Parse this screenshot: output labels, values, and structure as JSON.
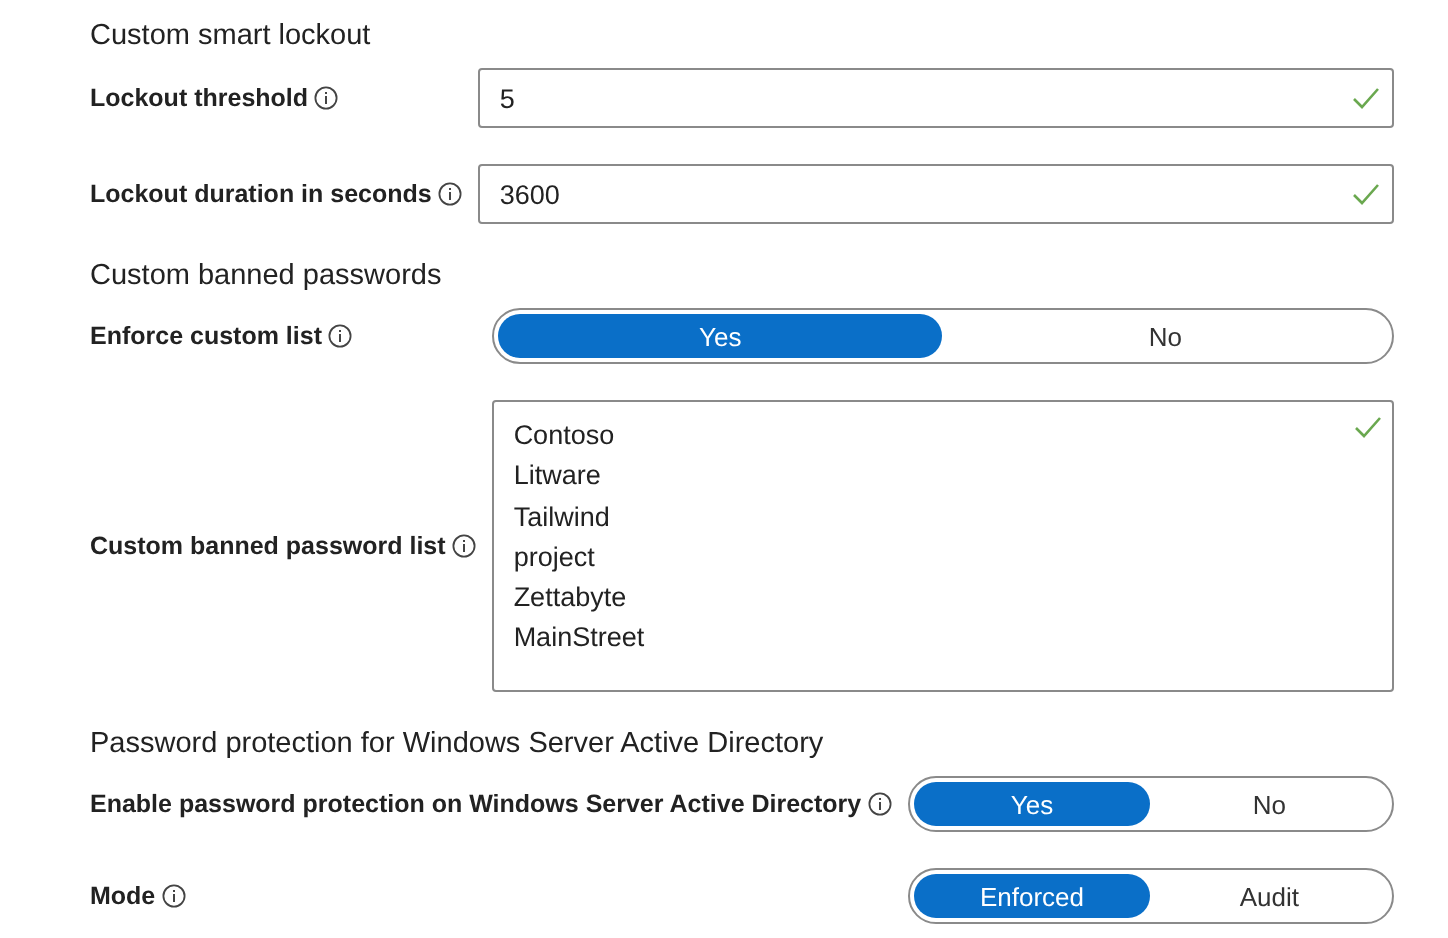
{
  "sections": [
    {
      "heading": "Custom smart lockout",
      "rows": [
        {
          "kind": "input",
          "label": "Lockout threshold",
          "info": true,
          "value": "5",
          "valid": true
        },
        {
          "kind": "input",
          "label": "Lockout duration in seconds",
          "info": true,
          "value": "3600",
          "valid": true
        }
      ]
    },
    {
      "heading": "Custom banned passwords",
      "rows": [
        {
          "kind": "toggle",
          "label": "Enforce custom list",
          "info": true,
          "options": [
            {
              "label": "Yes",
              "selected": true
            },
            {
              "label": "No",
              "selected": false
            }
          ]
        },
        {
          "kind": "list",
          "label": "Custom banned password list",
          "info": true,
          "lines": [
            "Contoso",
            "Litware",
            "Tailwind",
            "project",
            "Zettabyte",
            "MainStreet"
          ],
          "valid": true
        }
      ]
    },
    {
      "heading": "Password protection for Windows Server Active Directory",
      "rows": [
        {
          "kind": "toggle",
          "label": "Enable password protection on Windows Server Active Directory",
          "info": true,
          "options": [
            {
              "label": "Yes",
              "selected": true
            },
            {
              "label": "No",
              "selected": false
            }
          ]
        },
        {
          "kind": "toggle",
          "label": "Mode",
          "info": true,
          "options": [
            {
              "label": "Enforced",
              "selected": true
            },
            {
              "label": "Audit",
              "selected": false
            }
          ]
        }
      ]
    }
  ]
}
